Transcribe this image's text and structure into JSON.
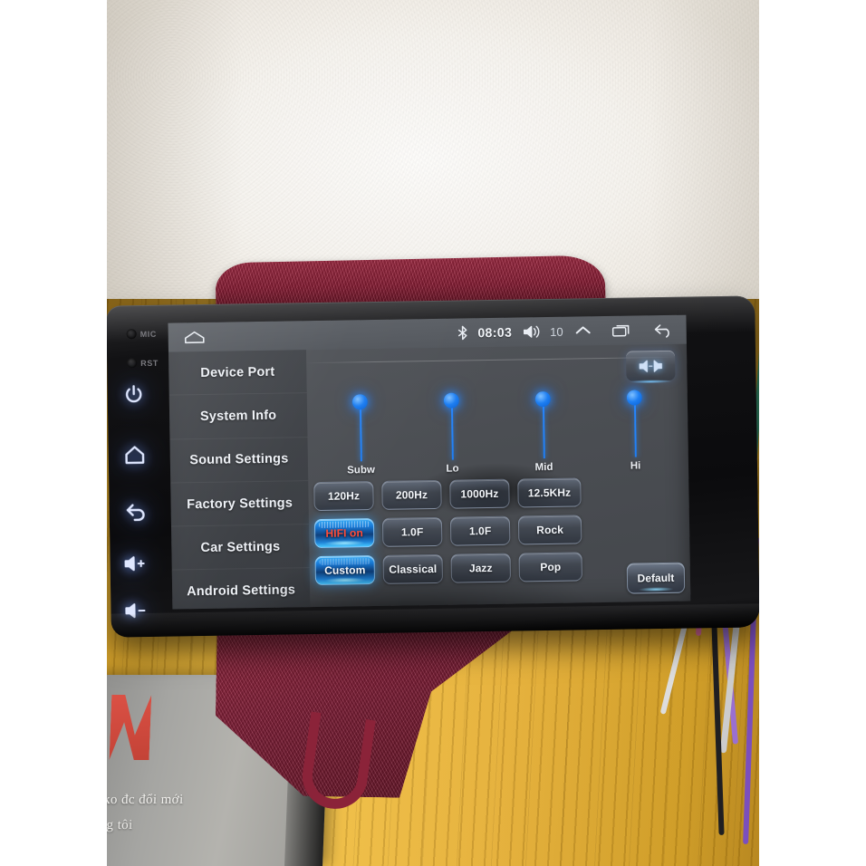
{
  "device": {
    "bezel": {
      "mic_label": "MIC",
      "rst_label": "RST",
      "buttons": [
        {
          "name": "power-button",
          "icon": "power-icon"
        },
        {
          "name": "home-button",
          "icon": "home-icon"
        },
        {
          "name": "back-button",
          "icon": "back-arrow-icon"
        },
        {
          "name": "volume-up-button",
          "icon": "volume-up-icon"
        },
        {
          "name": "volume-down-button",
          "icon": "volume-down-icon"
        }
      ]
    }
  },
  "statusbar": {
    "home_icon": "home-outline-icon",
    "bluetooth_icon": "bluetooth-icon",
    "clock": "08:03",
    "volume_icon": "volume-icon",
    "volume_level": "10",
    "chevron_icon": "chevron-up-icon",
    "recent_icon": "recent-apps-icon",
    "back_icon": "back-arrow-icon"
  },
  "sidebar": {
    "items": [
      {
        "label": "Device Port"
      },
      {
        "label": "System Info"
      },
      {
        "label": "Sound Settings"
      },
      {
        "label": "Factory Settings"
      },
      {
        "label": "Car Settings"
      },
      {
        "label": "Android Settings"
      }
    ]
  },
  "main": {
    "balance_button": {
      "icon": "balance-fader-icon",
      "label": ""
    },
    "equalizer": {
      "sliders": [
        {
          "label": "Subw",
          "value": 100
        },
        {
          "label": "Lo",
          "value": 100
        },
        {
          "label": "Mid",
          "value": 100
        },
        {
          "label": "Hi",
          "value": 100
        }
      ]
    },
    "grid": [
      [
        {
          "label": "120Hz",
          "active": false
        },
        {
          "label": "200Hz",
          "active": false
        },
        {
          "label": "1000Hz",
          "active": false
        },
        {
          "label": "12.5KHz",
          "active": false
        }
      ],
      [
        {
          "label": "HIFI on",
          "active": true,
          "style": "hifi"
        },
        {
          "label": "1.0F",
          "active": false
        },
        {
          "label": "1.0F",
          "active": false
        },
        {
          "label": "Rock",
          "active": false
        }
      ],
      [
        {
          "label": "Custom",
          "active": true
        },
        {
          "label": "Classical",
          "active": false
        },
        {
          "label": "Jazz",
          "active": false
        },
        {
          "label": "Pop",
          "active": false
        }
      ]
    ],
    "default_button": "Default"
  },
  "scene": {
    "paper_text": [
      "ẽ ko đc đổi mới",
      "ủng tôi",
      ""
    ]
  },
  "colors": {
    "accent_blue": "#1e7ef5",
    "active_button": "#31a8f5",
    "hifi_text": "#ff4d3a",
    "screen_bg": "#4b4e53",
    "statusbar_bg": "#5c6066",
    "desk_wood": "#e0ae33",
    "towel_red": "#8e2038"
  }
}
